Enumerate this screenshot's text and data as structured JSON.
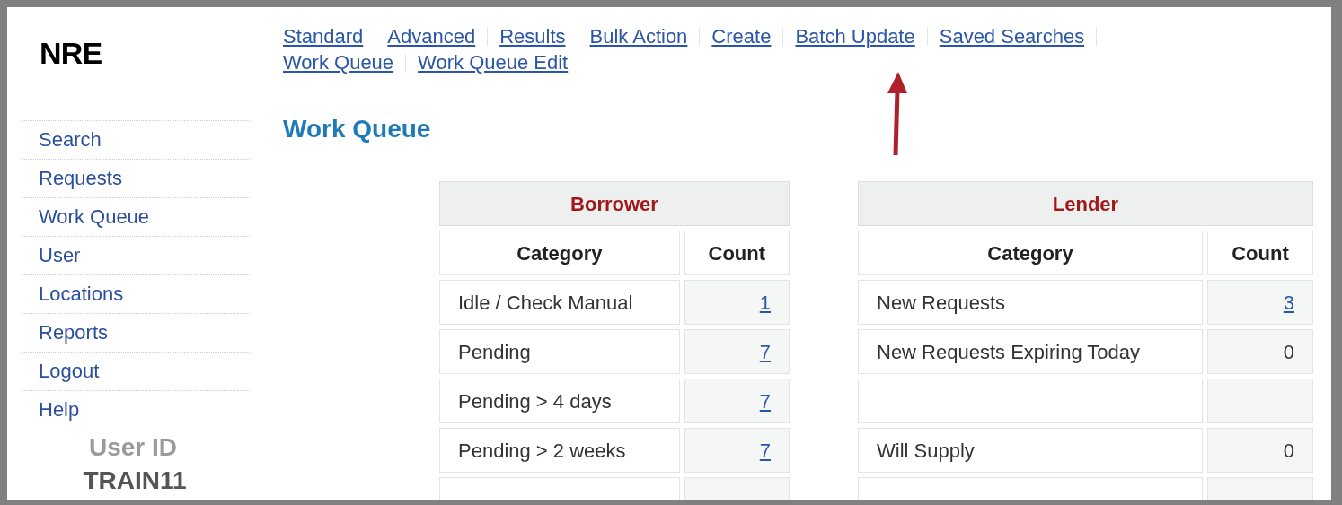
{
  "logo": "NRE",
  "nav_links": [
    {
      "label": "Standard"
    },
    {
      "label": "Advanced"
    },
    {
      "label": "Results"
    },
    {
      "label": "Bulk Action"
    },
    {
      "label": "Create"
    },
    {
      "label": "Batch Update"
    },
    {
      "label": "Saved Searches"
    },
    {
      "label": "Work Queue"
    },
    {
      "label": "Work Queue Edit"
    }
  ],
  "sidebar": {
    "items": [
      {
        "label": "Search"
      },
      {
        "label": "Requests"
      },
      {
        "label": "Work Queue"
      },
      {
        "label": "User"
      },
      {
        "label": "Locations"
      },
      {
        "label": "Reports"
      },
      {
        "label": "Logout"
      },
      {
        "label": "Help"
      }
    ],
    "user_id_label": "User ID",
    "user_id": "TRAIN11"
  },
  "page_title": "Work Queue",
  "tables": [
    {
      "title": "Borrower",
      "columns": [
        "Category",
        "Count"
      ],
      "rows": [
        {
          "kind": "entry",
          "category": "Idle / Check Manual",
          "count": "1",
          "link": true
        },
        {
          "kind": "entry",
          "category": "Pending",
          "count": "7",
          "link": true
        },
        {
          "kind": "entry",
          "category": "Pending > 4 days",
          "count": "7",
          "link": true
        },
        {
          "kind": "entry",
          "category": "Pending > 2 weeks",
          "count": "7",
          "link": true
        },
        {
          "kind": "blank"
        }
      ]
    },
    {
      "title": "Lender",
      "columns": [
        "Category",
        "Count"
      ],
      "rows": [
        {
          "kind": "entry",
          "category": "New Requests",
          "count": "3",
          "link": true
        },
        {
          "kind": "entry",
          "category": "New Requests Expiring Today",
          "count": "0",
          "link": false
        },
        {
          "kind": "blank"
        },
        {
          "kind": "entry",
          "category": "Will Supply",
          "count": "0",
          "link": false
        },
        {
          "kind": "blank"
        }
      ]
    }
  ]
}
